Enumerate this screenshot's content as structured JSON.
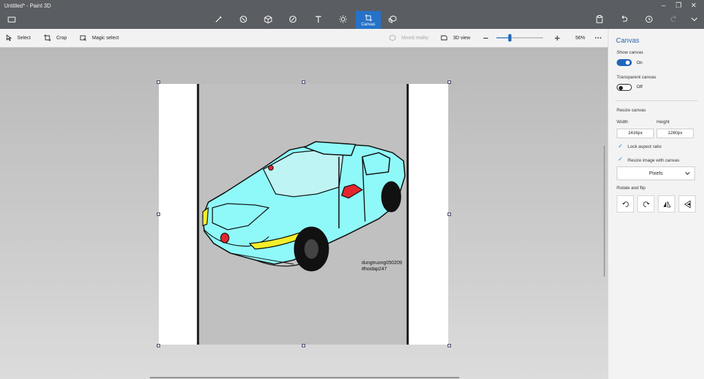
{
  "window": {
    "title": "Untitled* - Paint 3D"
  },
  "tabs": {
    "canvas_label": "Canvas"
  },
  "toolbar": {
    "select": "Select",
    "crop": "Crop",
    "magic_select": "Magic select",
    "mixed_reality": "Mixed reality",
    "view_3d": "3D view",
    "zoom": "56%",
    "zoom_fraction": 0.56
  },
  "panel": {
    "title": "Canvas",
    "show_canvas": {
      "label": "Show canvas",
      "state": "On"
    },
    "transparent_canvas": {
      "label": "Transparent canvas",
      "state": "Off"
    },
    "resize_label": "Resize canvas",
    "width_label": "Width",
    "height_label": "Height",
    "width_value": "1416px",
    "height_value": "1280px",
    "lock_aspect": "Lock aspect ratio",
    "resize_image": "Resize image with canvas",
    "units": "Pixels",
    "rotate_flip": "Rotate and flip"
  },
  "drawing": {
    "watermark_line1": "dungtruong050209",
    "watermark_line2": "#hoidap247",
    "colors": {
      "car_body": "#8ff9f9",
      "headlight": "#f5ee2a",
      "mirror": "#e3262d",
      "canvas_bg": "#c0c0c0"
    }
  }
}
